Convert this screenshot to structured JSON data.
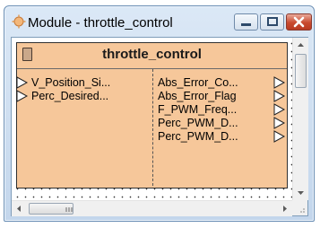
{
  "window": {
    "title": "Module - throttle_control",
    "icon": "module-icon",
    "buttons": [
      "minimize",
      "maximize",
      "close"
    ]
  },
  "block": {
    "name": "throttle_control",
    "fill_color": "#f6c79a",
    "inputs": [
      {
        "label": "V_Position_Si..."
      },
      {
        "label": "Perc_Desired..."
      }
    ],
    "outputs": [
      {
        "label": "Abs_Error_Co..."
      },
      {
        "label": "Abs_Error_Flag"
      },
      {
        "label": "F_PWM_Freq..."
      },
      {
        "label": "Perc_PWM_D..."
      },
      {
        "label": "Perc_PWM_D..."
      }
    ]
  },
  "scrollbars": {
    "vertical": {
      "up_icon": "scroll-up-icon",
      "down_icon": "scroll-down-icon"
    },
    "horizontal": {
      "left_icon": "scroll-left-icon",
      "right_icon": "scroll-right-icon"
    }
  }
}
